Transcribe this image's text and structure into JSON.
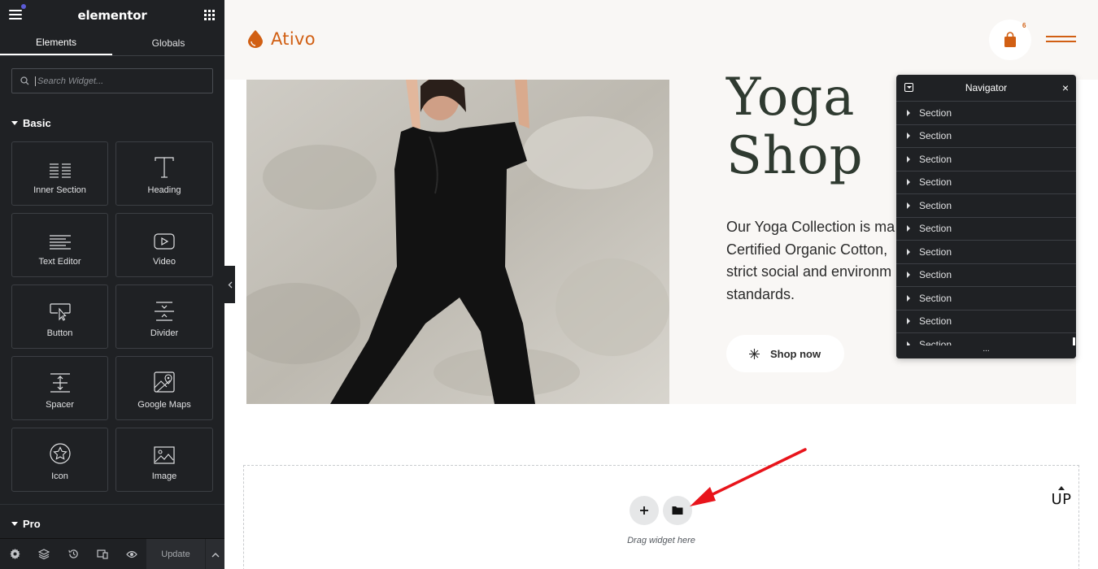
{
  "panel": {
    "logo": "elementor",
    "tabs": [
      "Elements",
      "Globals"
    ],
    "search_placeholder": "Search Widget...",
    "categories": {
      "basic": "Basic",
      "pro": "Pro"
    },
    "widgets": [
      {
        "label": "Inner Section",
        "icon": "inner-section-icon"
      },
      {
        "label": "Heading",
        "icon": "heading-icon"
      },
      {
        "label": "Text Editor",
        "icon": "text-editor-icon"
      },
      {
        "label": "Video",
        "icon": "video-icon"
      },
      {
        "label": "Button",
        "icon": "button-icon"
      },
      {
        "label": "Divider",
        "icon": "divider-icon"
      },
      {
        "label": "Spacer",
        "icon": "spacer-icon"
      },
      {
        "label": "Google Maps",
        "icon": "google-maps-icon"
      },
      {
        "label": "Icon",
        "icon": "star-icon"
      },
      {
        "label": "Image",
        "icon": "image-icon"
      }
    ],
    "footer": {
      "update_label": "Update"
    }
  },
  "site": {
    "brand": "Ativo",
    "cart_count": "6",
    "hero": {
      "title_line1": "Yoga",
      "title_line2": "Shop",
      "text_lines": [
        "Our Yoga Collection is ma",
        "Certified Organic Cotton,",
        "strict social and environm",
        "standards."
      ],
      "button_label": "Shop now"
    }
  },
  "navigator": {
    "title": "Navigator",
    "items": [
      "Section",
      "Section",
      "Section",
      "Section",
      "Section",
      "Section",
      "Section",
      "Section",
      "Section",
      "Section",
      "Section"
    ],
    "more": "..."
  },
  "dropzone": {
    "hint": "Drag widget here",
    "up_label": "UP"
  },
  "colors": {
    "panel_bg": "#1f2124",
    "brand_orange": "#d15f13",
    "hero_bg": "#f9f7f5",
    "annotation_red": "#e8141b"
  }
}
